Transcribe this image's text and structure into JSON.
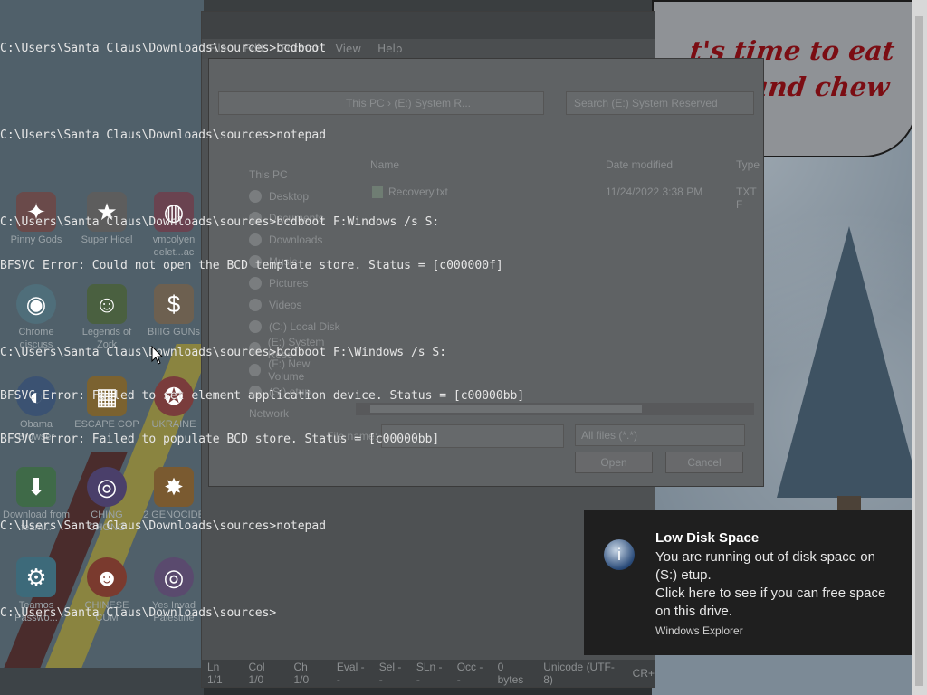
{
  "cmd": {
    "lines": [
      "C:\\Users\\Santa Claus\\Downloads\\sources>bcdboot",
      "",
      "C:\\Users\\Santa Claus\\Downloads\\sources>notepad",
      "",
      "C:\\Users\\Santa Claus\\Downloads\\sources>bcdboot F:Windows /s S:",
      "BFSVC Error: Could not open the BCD template store. Status = [c000000f]",
      "",
      "C:\\Users\\Santa Claus\\Downloads\\sources>bcdboot F:\\Windows /s S:",
      "BFSVC Error: Failed to set element application device. Status = [c00000bb]",
      "BFSVC Error: Failed to populate BCD store. Status = [c00000bb]",
      "",
      "C:\\Users\\Santa Claus\\Downloads\\sources>notepad",
      "",
      "C:\\Users\\Santa Claus\\Downloads\\sources>"
    ]
  },
  "wallpaper": {
    "speech_text": "t's time to eat shit and chew anes"
  },
  "desktop_icons": [
    {
      "label": "Pinny Gods",
      "glyph": "✦"
    },
    {
      "label": "Super Hicel",
      "glyph": "★"
    },
    {
      "label": "vmcolyen delet...ac",
      "glyph": "◍"
    },
    {
      "label": "Chrome discuss",
      "glyph": "◉"
    },
    {
      "label": "Legends of Zork",
      "glyph": "☺"
    },
    {
      "label": "BIIIG GUNs",
      "glyph": "$"
    },
    {
      "label": "Obama Browser",
      "glyph": "◐"
    },
    {
      "label": "ESCAPE COP",
      "glyph": "▦"
    },
    {
      "label": "UKRAINE",
      "glyph": "✪"
    },
    {
      "label": "Download from feam...",
      "glyph": "⬇"
    },
    {
      "label": "CHING CHONG",
      "glyph": "◎"
    },
    {
      "label": "2 GENOCIDE",
      "glyph": "✸"
    },
    {
      "label": "Teamos Passwo...",
      "glyph": "⚙"
    },
    {
      "label": "CHINESE CUM",
      "glyph": "☻"
    },
    {
      "label": "Yes Invad Palestine",
      "glyph": "◎"
    }
  ],
  "notepad": {
    "menu": [
      "File",
      "Edit",
      "Format",
      "View",
      "Help"
    ],
    "status": [
      "Ln 1/1",
      "Col 1/0",
      "Ch 1/0",
      "Eval --",
      "Sel --",
      "SLn --",
      "Occ --",
      "0 bytes",
      "Unicode (UTF-8)",
      "CR+"
    ]
  },
  "open_dialog": {
    "address": "This PC › (E:) System R...",
    "search_placeholder": "Search (E:) System Reserved",
    "nav_items": [
      "This PC",
      "Desktop",
      "Documents",
      "Downloads",
      "Music",
      "Pictures",
      "Videos",
      "(C:) Local Disk",
      "(E:) System Rese",
      "(F:) New Volume",
      "(S:) etup",
      "Network"
    ],
    "columns": {
      "name": "Name",
      "date": "Date modified",
      "type": "Type"
    },
    "files": [
      {
        "name": "Recovery.txt",
        "date": "11/24/2022 3:38 PM",
        "type": "TXT F"
      }
    ],
    "file_name_label": "File name:",
    "file_name_value": "",
    "filter": "All files (*.*)",
    "open_label": "Open",
    "cancel_label": "Cancel"
  },
  "toast": {
    "title": "Low Disk Space",
    "message_1": "You are running out of disk space on (S:) etup.",
    "message_2": "Click here to see if you can free space on this drive.",
    "source": "Windows Explorer"
  },
  "colors": {
    "toast_bg": "#1f1f1f",
    "cmd_text": "#e6e6e6"
  }
}
